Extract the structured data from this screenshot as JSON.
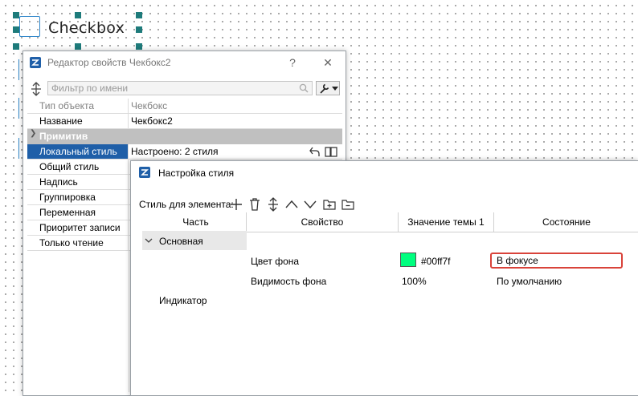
{
  "canvas": {
    "checkbox_label": "Checkbox",
    "handle_color": "#1e7b7b",
    "selection_color": "#2f86c9"
  },
  "property_editor": {
    "title": "Редактор свойств Чекбокс2",
    "help_label": "?",
    "close_label": "✕",
    "filter_placeholder": "Фильтр по имени",
    "rows": [
      {
        "name": "Тип объекта",
        "value": "Чекбокс"
      },
      {
        "name": "Название",
        "value": "Чекбокс2"
      },
      {
        "name": "Примитив",
        "value": ""
      },
      {
        "name": "Локальный стиль",
        "value": "Настроено: 2 стиля"
      },
      {
        "name": "Общий стиль",
        "value": ""
      },
      {
        "name": "Надпись",
        "value": ""
      },
      {
        "name": "Группировка",
        "value": ""
      },
      {
        "name": "Переменная",
        "value": ""
      },
      {
        "name": "Приоритет записи",
        "value": ""
      },
      {
        "name": "Только чтение",
        "value": ""
      }
    ]
  },
  "style_dialog": {
    "title": "Настройка стиля",
    "toolbar_label": "Стиль для элемента:",
    "columns": [
      "Часть",
      "Свойство",
      "Значение темы 1",
      "Состояние"
    ],
    "rows": [
      {
        "part": "Основная",
        "property": "",
        "value": "",
        "state": ""
      },
      {
        "part": "",
        "property": "Цвет фона",
        "value": "#00ff7f",
        "swatch": "#00ff7f",
        "state": "В фокусе"
      },
      {
        "part": "",
        "property": "Видимость фона",
        "value": "100%",
        "state": "По умолчанию"
      },
      {
        "part": "Индикатор",
        "property": "",
        "value": "",
        "state": ""
      }
    ]
  },
  "colors": {
    "accent": "#1f5fa8",
    "group_row": "#c0c0c0",
    "highlight_border": "#d9433a"
  }
}
